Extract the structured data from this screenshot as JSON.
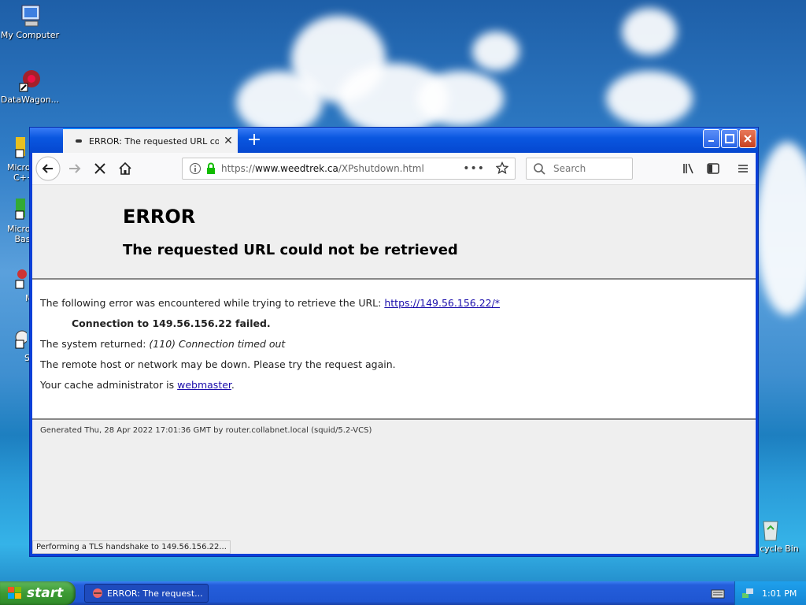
{
  "desktop": {
    "icons": [
      {
        "label": "My Computer"
      },
      {
        "label": "DataWagon..."
      },
      {
        "label": "Microso C++"
      },
      {
        "label": "Microso Basi"
      },
      {
        "label": "My"
      },
      {
        "label": "Ste"
      },
      {
        "label": "cycle Bin"
      }
    ]
  },
  "browser": {
    "tab_title": "ERROR: The requested URL could",
    "url_host": "www.weedtrek.ca",
    "url_prefix": "https://",
    "url_path": "/XPshutdown.html",
    "search_placeholder": "Search",
    "status_text": "Performing a TLS handshake to 149.56.156.22..."
  },
  "page": {
    "heading": "ERROR",
    "subheading": "The requested URL could not be retrieved",
    "line1_text": "The following error was encountered while trying to retrieve the URL: ",
    "line1_link": "https://149.56.156.22/*",
    "line2": "Connection to 149.56.156.22 failed.",
    "line3_text": "The system returned: ",
    "line3_italic": "(110) Connection timed out",
    "line4": "The remote host or network may be down. Please try the request again.",
    "line5_text": "Your cache administrator is ",
    "line5_link": "webmaster",
    "line5_end": ".",
    "footer": "Generated Thu, 28 Apr 2022 17:01:36 GMT by router.collabnet.local (squid/5.2-VCS)"
  },
  "taskbar": {
    "start_label": "start",
    "task_label": "ERROR: The request...",
    "clock": "1:01 PM"
  }
}
